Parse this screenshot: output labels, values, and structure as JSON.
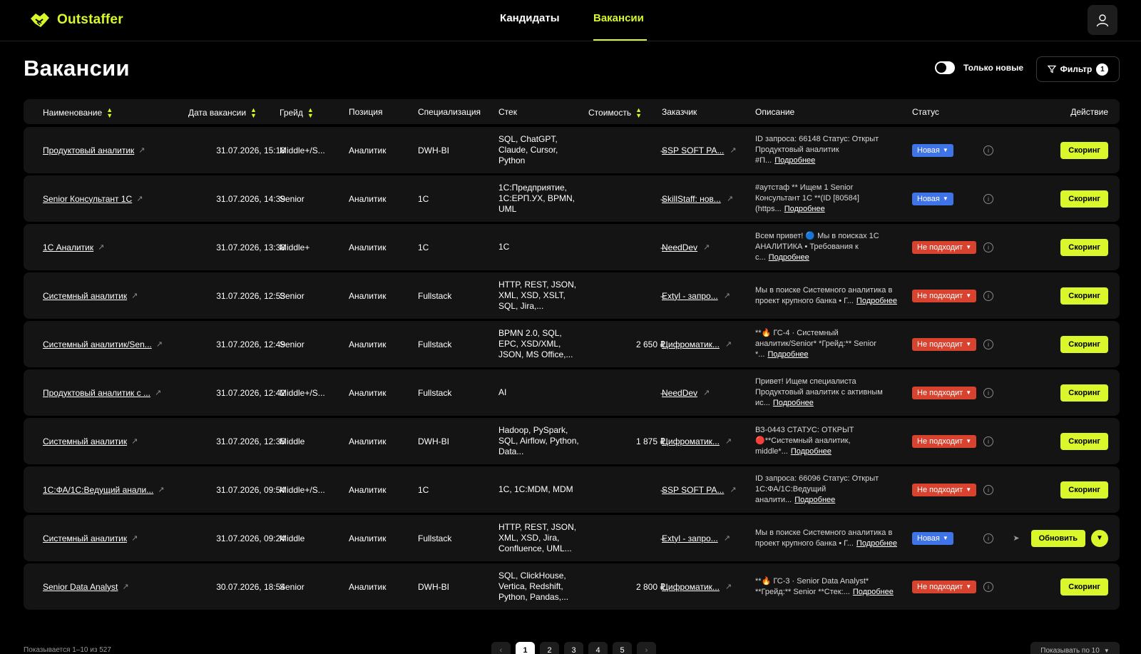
{
  "brand": {
    "name": "Outstaffer",
    "accent": "#d9f72b"
  },
  "nav": {
    "tabs": [
      {
        "label": "Кандидаты"
      },
      {
        "label": "Вакансии"
      }
    ],
    "active": "Вакансии"
  },
  "page": {
    "title": "Вакансии",
    "toggle_label": "Только новые",
    "filter_label": "Фильтр",
    "filter_count": "1"
  },
  "table": {
    "headers": {
      "name": "Наименование",
      "date": "Дата вакансии",
      "grade": "Грейд",
      "position": "Позиция",
      "spec": "Специализация",
      "stack": "Стек",
      "cost": "Стоимость",
      "customer": "Заказчик",
      "desc": "Описание",
      "status": "Статус",
      "action": "Действие"
    },
    "more_label": "Подробнее",
    "rows": [
      {
        "name": "Продуктовый аналитик",
        "date": "31.07.2026, 15:18",
        "grade": "Middle+/S...",
        "position": "Аналитик",
        "spec": "DWH-BI",
        "stack": "SQL, ChatGPT, Claude, Cursor, Python",
        "cost": "–",
        "customer": "SSP SOFT PA...",
        "desc": "ID запроса: 66148 Статус: Открыт Продуктовый аналитик #П...",
        "status": "Новая",
        "status_type": "new",
        "action": "Скоринг"
      },
      {
        "name": "Senior Консультант 1С",
        "date": "31.07.2026, 14:39",
        "grade": "Senior",
        "position": "Аналитик",
        "spec": "1С",
        "stack": "1С:Предприятие, 1С:ЕРП.УХ, BPMN, UML",
        "cost": "–",
        "customer": "SkillStaff: нов...",
        "desc": "#аутстаф ** Ищем 1 Senior Консультант 1С **(ID [80584](https...",
        "status": "Новая",
        "status_type": "new",
        "action": "Скоринг"
      },
      {
        "name": "1С Аналитик",
        "date": "31.07.2026, 13:38",
        "grade": "Middle+",
        "position": "Аналитик",
        "spec": "1С",
        "stack": "1С",
        "cost": "–",
        "customer": "NeedDev",
        "desc": "Всем привет! 🔵 Мы в поисках 1С АНАЛИТИКА • Требования к с...",
        "status": "Не подходит",
        "status_type": "bad",
        "action": "Скоринг"
      },
      {
        "name": "Системный аналитик",
        "date": "31.07.2026, 12:53",
        "grade": "Senior",
        "position": "Аналитик",
        "spec": "Fullstack",
        "stack": "HTTP, REST, JSON, XML, XSD, XSLT, SQL, Jira,...",
        "cost": "–",
        "customer": "Extyl - запро...",
        "desc": "Мы в поиске Системного аналитика в проект крупного банка • Г...",
        "status": "Не подходит",
        "status_type": "bad",
        "action": "Скоринг"
      },
      {
        "name": "Системный аналитик/Sen...",
        "date": "31.07.2026, 12:49",
        "grade": "Senior",
        "position": "Аналитик",
        "spec": "Fullstack",
        "stack": "BPMN 2.0, SQL, EPC, XSD/XML, JSON, MS Office,...",
        "cost": "2 650 ₽",
        "customer": "Цифроматик...",
        "desc": "**🔥 ГС-4 · Системный аналитик/Senior* *Грейд:** Senior *...",
        "status": "Не подходит",
        "status_type": "bad",
        "action": "Скоринг"
      },
      {
        "name": "Продуктовый аналитик с ...",
        "date": "31.07.2026, 12:42",
        "grade": "Middle+/S...",
        "position": "Аналитик",
        "spec": "Fullstack",
        "stack": "AI",
        "cost": "–",
        "customer": "NeedDev",
        "desc": "Привет! Ищем специалиста Продуктовый аналитик с активным ис...",
        "status": "Не подходит",
        "status_type": "bad",
        "action": "Скоринг"
      },
      {
        "name": "Системный аналитик",
        "date": "31.07.2026, 12:35",
        "grade": "Middle",
        "position": "Аналитик",
        "spec": "DWH-BI",
        "stack": "Hadoop, PySpark, SQL, Airflow, Python, Data...",
        "cost": "1 875 ₽",
        "customer": "Цифроматик...",
        "desc": "ВЗ-0443 СТАТУС: ОТКРЫТ 🔴**Системный аналитик, middle*...",
        "status": "Не подходит",
        "status_type": "bad",
        "action": "Скоринг"
      },
      {
        "name": "1С:ФА/1С:Ведущий анали...",
        "date": "31.07.2026, 09:54",
        "grade": "Middle+/S...",
        "position": "Аналитик",
        "spec": "1С",
        "stack": "1С, 1С:MDM, MDM",
        "cost": "–",
        "customer": "SSP SOFT PA...",
        "desc": "ID запроса: 66096 Статус: Открыт 1С:ФА/1С:Ведущий аналити...",
        "status": "Не подходит",
        "status_type": "bad",
        "action": "Скоринг"
      },
      {
        "name": "Системный аналитик",
        "date": "31.07.2026, 09:24",
        "grade": "Middle",
        "position": "Аналитик",
        "spec": "Fullstack",
        "stack": "HTTP, REST, JSON, XML, XSD, Jira, Confluence, UML...",
        "cost": "–",
        "customer": "Extyl - запро...",
        "desc": "Мы в поиске Системного аналитика в проект крупного банка • Г...",
        "status": "Новая",
        "status_type": "new",
        "action": "Обновить",
        "expandable": true
      },
      {
        "name": "Senior Data Analyst",
        "date": "30.07.2026, 18:54",
        "grade": "Senior",
        "position": "Аналитик",
        "spec": "DWH-BI",
        "stack": "SQL, ClickHouse, Vertica, Redshift, Python, Pandas,...",
        "cost": "2 800 ₽",
        "customer": "Цифроматик...",
        "desc": "**🔥 ГС-3 · Senior Data Analyst* **Грейд:** Senior **Стек:...",
        "status": "Не подходит",
        "status_type": "bad",
        "action": "Скоринг"
      }
    ]
  },
  "footer": {
    "showing": "Показывается 1–10 из 527",
    "pages": [
      "1",
      "2",
      "3",
      "4",
      "5"
    ],
    "active_page": "1",
    "per_page": "Показывать по 10"
  }
}
